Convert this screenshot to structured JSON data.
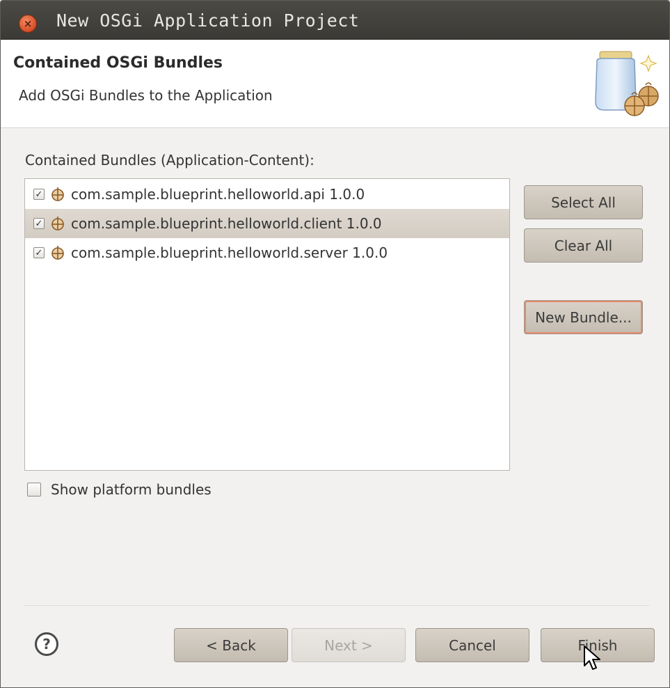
{
  "window": {
    "title": "New OSGi Application Project",
    "close_glyph": "×"
  },
  "banner": {
    "title": "Contained OSGi Bundles",
    "description": "Add OSGi Bundles to the Application"
  },
  "content": {
    "list_label": "Contained Bundles (Application-Content):",
    "bundles": [
      {
        "label": "com.sample.blueprint.helloworld.api 1.0.0",
        "checked": true,
        "selected": false
      },
      {
        "label": "com.sample.blueprint.helloworld.client 1.0.0",
        "checked": true,
        "selected": true
      },
      {
        "label": "com.sample.blueprint.helloworld.server 1.0.0",
        "checked": true,
        "selected": false
      }
    ],
    "check_glyph": "✓",
    "side_buttons": {
      "select_all": "Select All",
      "clear_all": "Clear All",
      "new_bundle": "New Bundle..."
    },
    "show_platform_label": "Show platform bundles"
  },
  "footer": {
    "help_glyph": "?",
    "back": "< Back",
    "next": "Next >",
    "cancel": "Cancel",
    "finish": "Finish"
  },
  "colors": {
    "titlebar": "#3b3a36",
    "selection": "#d2ccc3",
    "button": "#c4bcb0",
    "focus_ring": "#e88a6c"
  }
}
